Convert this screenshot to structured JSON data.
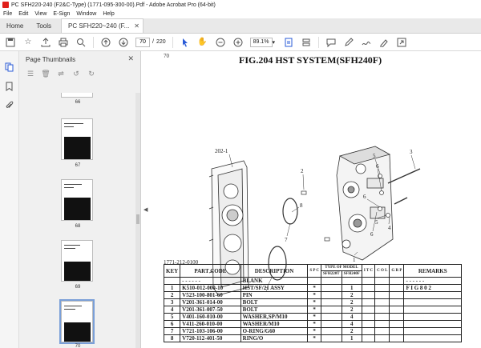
{
  "window": {
    "title": "PC SFH220-240 (F2&C-Type) (1771-095-300-00).Pdf - Adobe Acrobat Pro (64-bit)"
  },
  "menu": [
    "File",
    "Edit",
    "View",
    "E-Sign",
    "Window",
    "Help"
  ],
  "tabs": {
    "home": "Home",
    "tools": "Tools",
    "doc": "PC SFH220~240 (F..."
  },
  "toolbar": {
    "page_current": "70",
    "page_total": "220",
    "page_sep": "/",
    "zoom": "89.1%"
  },
  "panel": {
    "title": "Page Thumbnails",
    "thumbnails": [
      {
        "num": "66"
      },
      {
        "num": "67"
      },
      {
        "num": "68"
      },
      {
        "num": "69"
      },
      {
        "num": "70"
      }
    ]
  },
  "document": {
    "page_label": "70",
    "fig_title": "FIG.204  HST SYSTEM(SFH240F)",
    "ref_code": "1771-212-0100",
    "callouts": [
      "202-1",
      "2",
      "8",
      "7",
      "7",
      "1",
      "5",
      "6",
      "3",
      "6",
      "4",
      "6",
      "5"
    ],
    "table": {
      "headers": {
        "key": "KEY",
        "part_code": "PART CODE",
        "description": "DESCRIPTION",
        "spc": "S P C",
        "type_of_model": "TYPE OF MODEL",
        "sfh220t": "SFH220T",
        "sfh240f": "SFH240F",
        "itc": "I T C",
        "col": "C O L",
        "grp": "G R P",
        "remarks": "REMARKS"
      },
      "rows": [
        {
          "key": "",
          "code": "- - - - - -",
          "desc": "BLANK",
          "spc": "",
          "t220": "",
          "t240": "",
          "remarks": "- - - - - -"
        },
        {
          "key": "1",
          "code": "K510-012-000-10",
          "desc": "HST/SF/21        ASSY",
          "spc": "*",
          "t220": "",
          "t240": "1",
          "remarks": "F I G  8 0 2"
        },
        {
          "key": "2",
          "code": "V523-100-801-60",
          "desc": "PIN",
          "spc": "*",
          "t220": "",
          "t240": "2",
          "remarks": ""
        },
        {
          "key": "3",
          "code": "V201-361-014-00",
          "desc": "BOLT",
          "spc": "*",
          "t220": "",
          "t240": "2",
          "remarks": ""
        },
        {
          "key": "4",
          "code": "V201-361-007-50",
          "desc": "BOLT",
          "spc": "*",
          "t220": "",
          "t240": "2",
          "remarks": ""
        },
        {
          "key": "5",
          "code": "V401-160-010-00",
          "desc": "WASHER,SP/M10",
          "spc": "*",
          "t220": "",
          "t240": "4",
          "remarks": ""
        },
        {
          "key": "6",
          "code": "V411-260-010-00",
          "desc": "WASHER/M10",
          "spc": "*",
          "t220": "",
          "t240": "4",
          "remarks": ""
        },
        {
          "key": "7",
          "code": "V721-103-106-00",
          "desc": "O-RING/G60",
          "spc": "*",
          "t220": "",
          "t240": "2",
          "remarks": ""
        },
        {
          "key": "8",
          "code": "V720-112-401-50",
          "desc": "RING/O",
          "spc": "*",
          "t220": "",
          "t240": "1",
          "remarks": ""
        }
      ]
    }
  }
}
